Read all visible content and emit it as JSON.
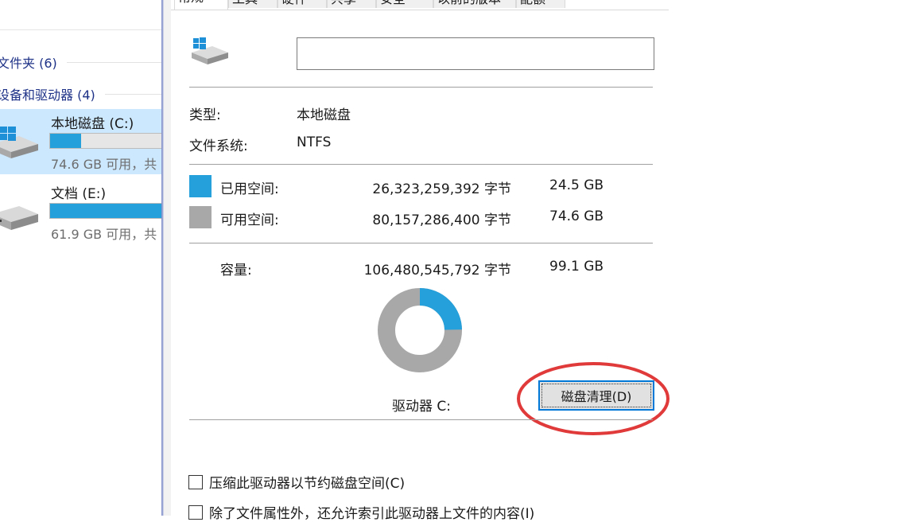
{
  "explorer": {
    "groups": [
      {
        "label": "文件夹 (6)"
      },
      {
        "label": "设备和驱动器 (4)"
      }
    ],
    "drives": [
      {
        "name": "本地磁盘 (C:)",
        "info": "74.6 GB 可用，共",
        "used_fraction": 0.247,
        "selected": true
      },
      {
        "name": "文档 (E:)",
        "info": "61.9 GB 可用，共",
        "used_fraction": 0.9,
        "selected": false
      }
    ]
  },
  "dialog": {
    "tabs": [
      "常规",
      "工具",
      "硬件",
      "共享",
      "安全",
      "以前的版本",
      "配额"
    ],
    "name_input_value": "",
    "type_label": "类型:",
    "type_value": "本地磁盘",
    "fs_label": "文件系统:",
    "fs_value": "NTFS",
    "used": {
      "label": "已用空间:",
      "bytes": "26,323,259,392 字节",
      "size": "24.5 GB",
      "color": "#26a0da"
    },
    "free": {
      "label": "可用空间:",
      "bytes": "80,157,286,400 字节",
      "size": "74.6 GB",
      "color": "#a8a8a8"
    },
    "capacity": {
      "label": "容量:",
      "bytes": "106,480,545,792 字节",
      "size": "99.1 GB"
    },
    "drive_caption": "驱动器 C:",
    "cleanup_button": "磁盘清理(D)",
    "used_fraction": 0.247,
    "checkboxes": [
      {
        "label": "压缩此驱动器以节约磁盘空间(C)",
        "checked": false
      },
      {
        "label": "除了文件属性外，还允许索引此驱动器上文件的内容(I)",
        "checked": false
      }
    ],
    "highlight_color": "#e03a3a"
  }
}
